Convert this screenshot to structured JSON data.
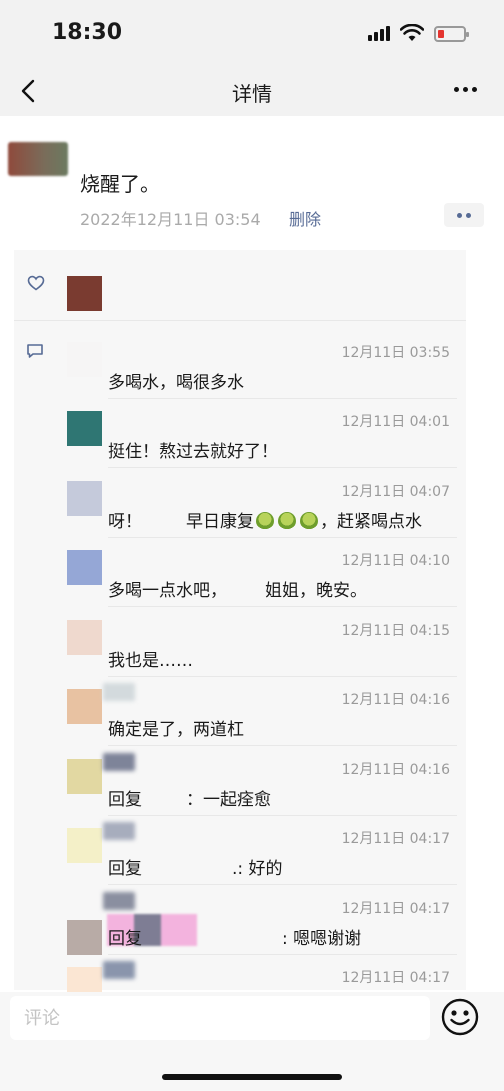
{
  "status_bar": {
    "time": "18:30"
  },
  "nav": {
    "title": "详情"
  },
  "post": {
    "text": "烧醒了。",
    "timestamp": "2022年12月11日 03:54",
    "delete_label": "删除"
  },
  "comments": [
    {
      "time": "12月11日 03:55",
      "text": "多喝水，喝很多水"
    },
    {
      "time": "12月11日 04:01",
      "text": "挺住！熬过去就好了！"
    },
    {
      "time": "12月11日 04:07",
      "text_a": "呀！",
      "text_b": "早日康复",
      "text_c": "，赶紧喝点水"
    },
    {
      "time": "12月11日 04:10",
      "text_a": "多喝一点水吧，",
      "text_b": "姐姐，晚安。"
    },
    {
      "time": "12月11日 04:15",
      "text": "我也是……"
    },
    {
      "time": "12月11日 04:16",
      "text": "确定是了，两道杠"
    },
    {
      "time": "12月11日 04:16",
      "text_a": "回复",
      "text_b": "：一起痊愈"
    },
    {
      "time": "12月11日 04:17",
      "text_a": "回复",
      "text_b": ".: 好的"
    },
    {
      "time": "12月11日 04:17",
      "text_a": "回复",
      "text_b": ": 嗯嗯谢谢"
    },
    {
      "time": "12月11日 04:17"
    }
  ],
  "input": {
    "placeholder": "评论"
  },
  "icons": {
    "like": "heart-icon",
    "comment": "comment-icon",
    "emoji": "smiley-icon",
    "back": "back-icon",
    "more": "more-icon"
  },
  "colors": {
    "link": "#576b95",
    "meta": "#aaaaaa",
    "battery_low": "#e4342f"
  }
}
